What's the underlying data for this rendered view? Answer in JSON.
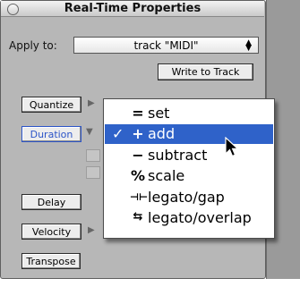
{
  "window": {
    "title": "Real-Time Properties"
  },
  "apply_to": {
    "label": "Apply to:",
    "value": "track \"MIDI\""
  },
  "write_to_track_label": "Write to Track",
  "sections": [
    {
      "label": "Quantize"
    },
    {
      "label": "Duration"
    },
    {
      "label": "Delay"
    },
    {
      "label": "Velocity"
    },
    {
      "label": "Transpose"
    }
  ],
  "menu": {
    "items": [
      {
        "icon": "=",
        "label": "set",
        "checked": "",
        "highlighted": false
      },
      {
        "icon": "+",
        "label": "add",
        "checked": "✓",
        "highlighted": true
      },
      {
        "icon": "−",
        "label": "subtract",
        "checked": "",
        "highlighted": false
      },
      {
        "icon": "%",
        "label": "scale",
        "checked": "",
        "highlighted": false
      },
      {
        "icon": "⊣⊢",
        "label": "legato/gap",
        "checked": "",
        "highlighted": false
      },
      {
        "icon": "⇆",
        "label": "legato/overlap",
        "checked": "",
        "highlighted": false
      }
    ]
  },
  "colors": {
    "highlight": "#2f62c9",
    "active_button": "#2d55c8",
    "window_bg": "#b7b7b7"
  }
}
